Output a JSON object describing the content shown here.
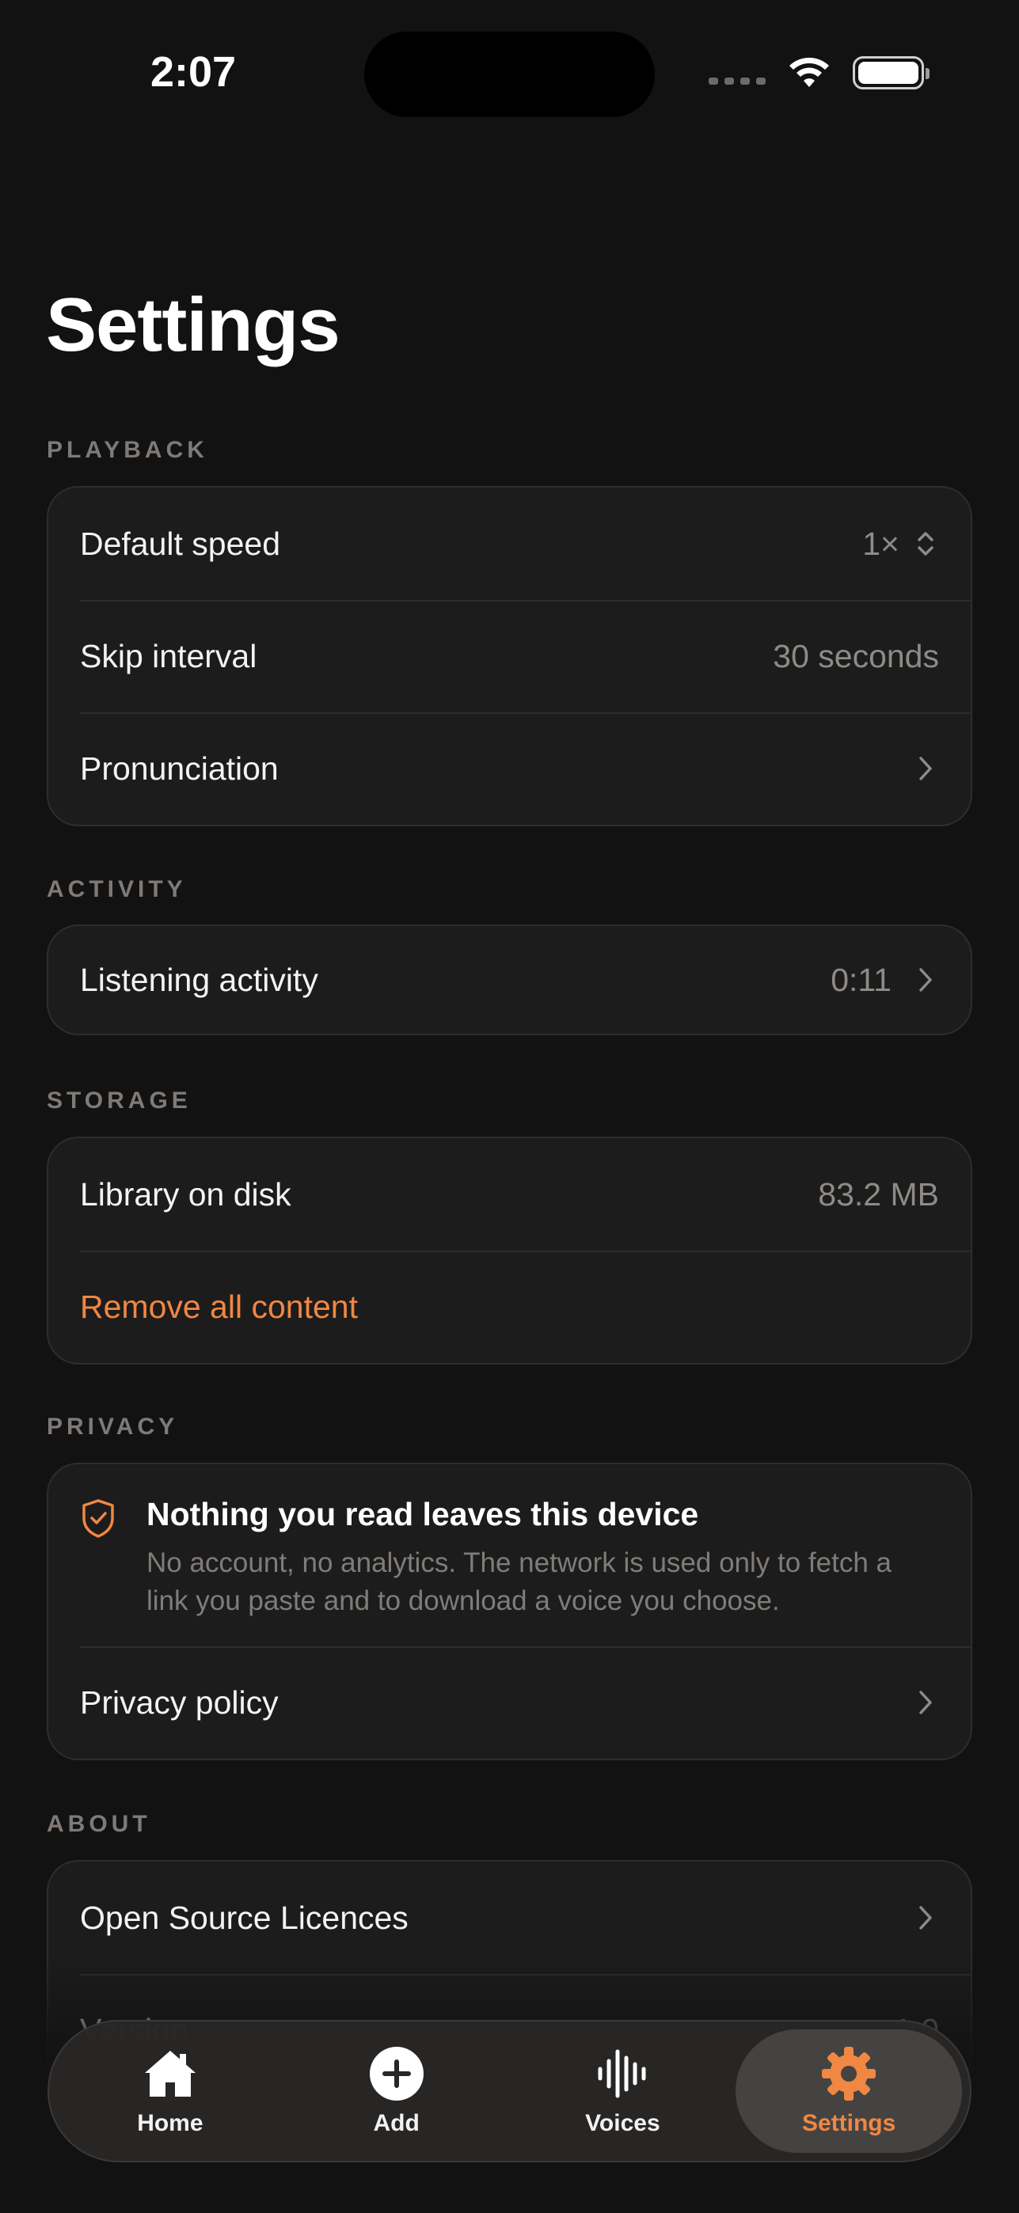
{
  "status": {
    "time": "2:07"
  },
  "page": {
    "title": "Settings"
  },
  "sections": {
    "playback": {
      "label": "PLAYBACK",
      "default_speed": {
        "label": "Default speed",
        "value": "1×"
      },
      "skip_interval": {
        "label": "Skip interval",
        "value": "30 seconds"
      },
      "pronunciation": {
        "label": "Pronunciation"
      }
    },
    "activity": {
      "label": "ACTIVITY",
      "listening": {
        "label": "Listening activity",
        "value": "0:11"
      }
    },
    "storage": {
      "label": "STORAGE",
      "library": {
        "label": "Library on disk",
        "value": "83.2 MB"
      },
      "remove": {
        "label": "Remove all content"
      }
    },
    "privacy": {
      "label": "PRIVACY",
      "notice_title": "Nothing you read leaves this device",
      "notice_desc": "No account, no analytics. The network is used only to fetch a link you paste and to download a voice you choose.",
      "policy": {
        "label": "Privacy policy"
      }
    },
    "about": {
      "label": "ABOUT",
      "licences": {
        "label": "Open Source Licences"
      },
      "version": {
        "label": "Version",
        "value": "1.0"
      }
    }
  },
  "tabs": [
    {
      "label": "Home",
      "icon": "home-icon"
    },
    {
      "label": "Add",
      "icon": "plus-circle-icon"
    },
    {
      "label": "Voices",
      "icon": "waveform-icon"
    },
    {
      "label": "Settings",
      "icon": "gear-icon"
    }
  ],
  "colors": {
    "accent": "#f08743",
    "background": "#131212",
    "card": "#1d1c1c"
  }
}
